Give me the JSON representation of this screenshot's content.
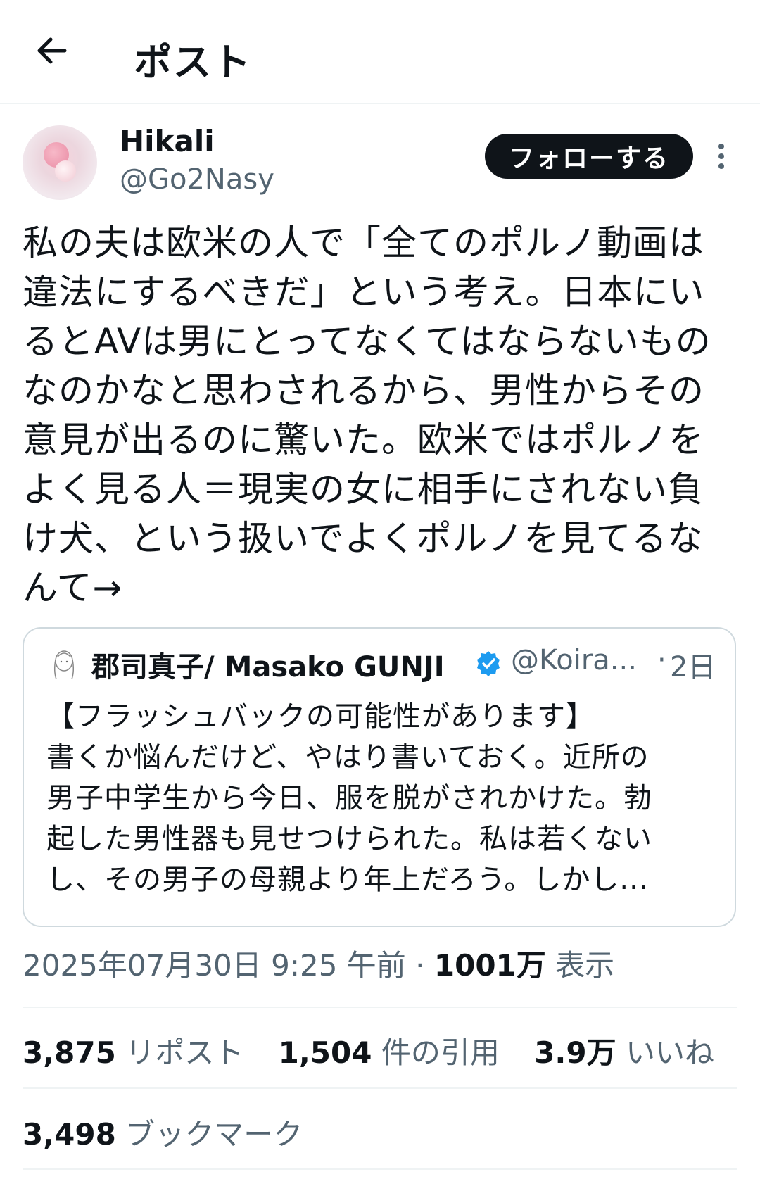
{
  "header": {
    "title": "ポスト"
  },
  "author": {
    "display_name": "Hikali",
    "handle": "@Go2Nasy",
    "follow_label": "フォローする"
  },
  "tweet": {
    "lines": [
      "私の夫は欧米の人で「全てのポルノ動画は",
      "違法にするべきだ」という考え。日本にい",
      "るとAVは男にとってなくてはならないもの",
      "なのかなと思わされるから、男性からその",
      "意見が出るのに驚いた。欧米ではポルノを",
      "よく見る人＝現実の女に相手にされない負",
      "け犬、という扱いでよくポルノを見てるな",
      "んて→"
    ]
  },
  "quote": {
    "name": "郡司真子/ Masako GUNJI",
    "handle": "@Koira...",
    "dot": "·",
    "time": "2日",
    "lines": [
      "【フラッシュバックの可能性があります】",
      "書くか悩んだけど、やはり書いておく。近所の",
      "男子中学生から今日、服を脱がされかけた。勃",
      "起した男性器も見せつけられた。私は若くない",
      "し、その男子の母親より年上だろう。しかし..."
    ]
  },
  "meta": {
    "timestamp": "2025年07月30日 9:25 午前",
    "sep": "·",
    "views_count": "1001万",
    "views_label": "表示"
  },
  "stats": {
    "reposts": {
      "count": "3,875",
      "label": "リポスト"
    },
    "quotes": {
      "count": "1,504",
      "label": "件の引用"
    },
    "likes": {
      "count": "3.9万",
      "label": "いいね"
    },
    "bookmarks": {
      "count": "3,498",
      "label": "ブックマーク"
    }
  },
  "colors": {
    "text": "#0f1419",
    "secondary": "#536471",
    "border": "#cfd9de",
    "verified": "#1d9bf0"
  }
}
